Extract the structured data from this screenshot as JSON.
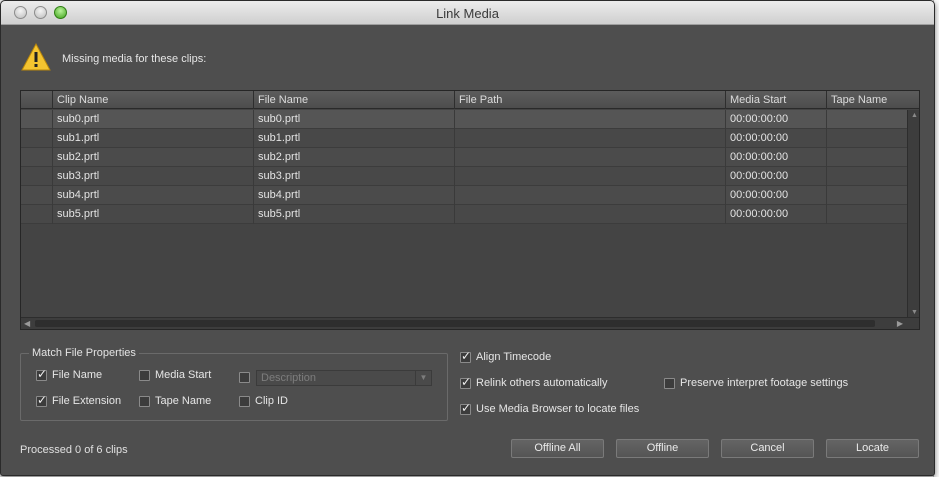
{
  "window": {
    "title": "Link Media"
  },
  "warning": {
    "icon": "warning-icon",
    "text": "Missing media for these clips:"
  },
  "table": {
    "columns": [
      "Clip Name",
      "File Name",
      "File Path",
      "Media Start",
      "Tape Name"
    ],
    "rows": [
      {
        "clip": "sub0.prtl",
        "file": "sub0.prtl",
        "path": "",
        "start": "00:00:00:00",
        "tape": ""
      },
      {
        "clip": "sub1.prtl",
        "file": "sub1.prtl",
        "path": "",
        "start": "00:00:00:00",
        "tape": ""
      },
      {
        "clip": "sub2.prtl",
        "file": "sub2.prtl",
        "path": "",
        "start": "00:00:00:00",
        "tape": ""
      },
      {
        "clip": "sub3.prtl",
        "file": "sub3.prtl",
        "path": "",
        "start": "00:00:00:00",
        "tape": ""
      },
      {
        "clip": "sub4.prtl",
        "file": "sub4.prtl",
        "path": "",
        "start": "00:00:00:00",
        "tape": ""
      },
      {
        "clip": "sub5.prtl",
        "file": "sub5.prtl",
        "path": "",
        "start": "00:00:00:00",
        "tape": ""
      }
    ]
  },
  "match": {
    "title": "Match File Properties",
    "file_name": {
      "label": "File Name",
      "checked": true
    },
    "media_start": {
      "label": "Media Start",
      "checked": false
    },
    "description": {
      "label": "Description",
      "checked": false
    },
    "file_extension": {
      "label": "File Extension",
      "checked": true
    },
    "tape_name": {
      "label": "Tape Name",
      "checked": false
    },
    "clip_id": {
      "label": "Clip ID",
      "checked": false
    }
  },
  "options": {
    "align_timecode": {
      "label": "Align Timecode",
      "checked": true
    },
    "relink_auto": {
      "label": "Relink others automatically",
      "checked": true
    },
    "preserve_interpret": {
      "label": "Preserve interpret footage settings",
      "checked": false
    },
    "use_media_browser": {
      "label": "Use Media Browser to locate files",
      "checked": true
    }
  },
  "status": "Processed 0 of 6 clips",
  "buttons": {
    "offline_all": "Offline All",
    "offline": "Offline",
    "cancel": "Cancel",
    "locate": "Locate"
  }
}
